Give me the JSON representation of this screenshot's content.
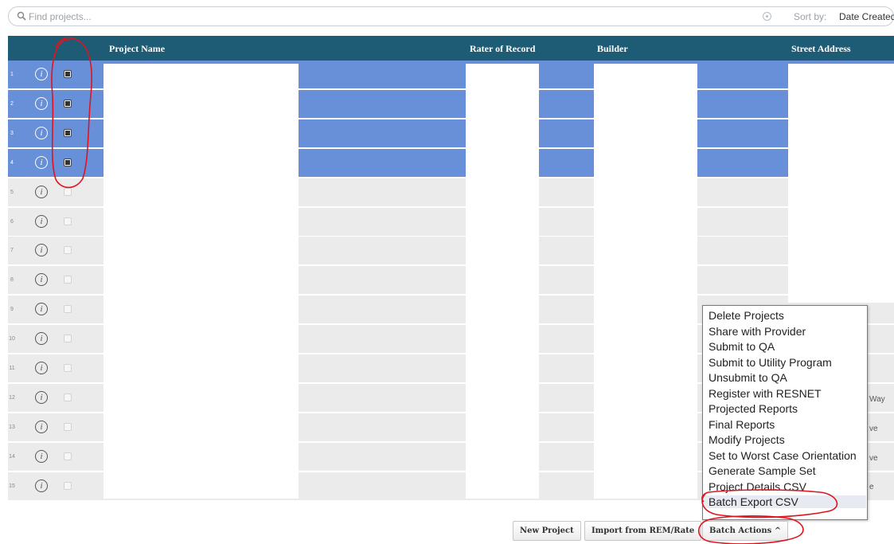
{
  "search": {
    "placeholder": "Find projects...",
    "sort_label": "Sort by:",
    "sort_value": "Date Created"
  },
  "table": {
    "headers": {
      "project_name": "Project Name",
      "rater_of_record": "Rater of Record",
      "builder": "Builder",
      "street_address": "Street Address"
    },
    "rows": [
      {
        "num": "1",
        "checked": true,
        "selected": true
      },
      {
        "num": "2",
        "checked": true,
        "selected": true
      },
      {
        "num": "3",
        "checked": true,
        "selected": true
      },
      {
        "num": "4",
        "checked": true,
        "selected": true
      },
      {
        "num": "5",
        "checked": false,
        "selected": false
      },
      {
        "num": "6",
        "checked": false,
        "selected": false
      },
      {
        "num": "7",
        "checked": false,
        "selected": false
      },
      {
        "num": "8",
        "checked": false,
        "selected": false
      },
      {
        "num": "9",
        "checked": false,
        "selected": false
      },
      {
        "num": "10",
        "checked": false,
        "selected": false
      },
      {
        "num": "11",
        "checked": false,
        "selected": false
      },
      {
        "num": "12",
        "checked": false,
        "selected": false
      },
      {
        "num": "13",
        "checked": false,
        "selected": false
      },
      {
        "num": "14",
        "checked": false,
        "selected": false
      },
      {
        "num": "15",
        "checked": false,
        "selected": false
      }
    ],
    "address_fragments": {
      "row12": "Way",
      "row13": "ve",
      "row14": "ve",
      "row15": "e"
    },
    "info_glyph": "i"
  },
  "batch_menu": {
    "items": [
      "Delete Projects",
      "Share with Provider",
      "Submit to QA",
      "Submit to Utility Program",
      "Unsubmit to QA",
      "Register with RESNET",
      "Projected Reports",
      "Final Reports",
      "Modify Projects",
      "Set to Worst Case Orientation",
      "Generate Sample Set",
      "Project Details CSV",
      "Batch Export CSV"
    ],
    "highlighted_index": 12
  },
  "buttons": {
    "new_project": "New Project",
    "import": "Import from REM/Rate",
    "batch_actions": "Batch Actions ^"
  },
  "colors": {
    "header_bg": "#1e5c75",
    "selected_row": "#6890d8",
    "row_bg": "#ebebeb",
    "annotation": "#e0141e"
  }
}
